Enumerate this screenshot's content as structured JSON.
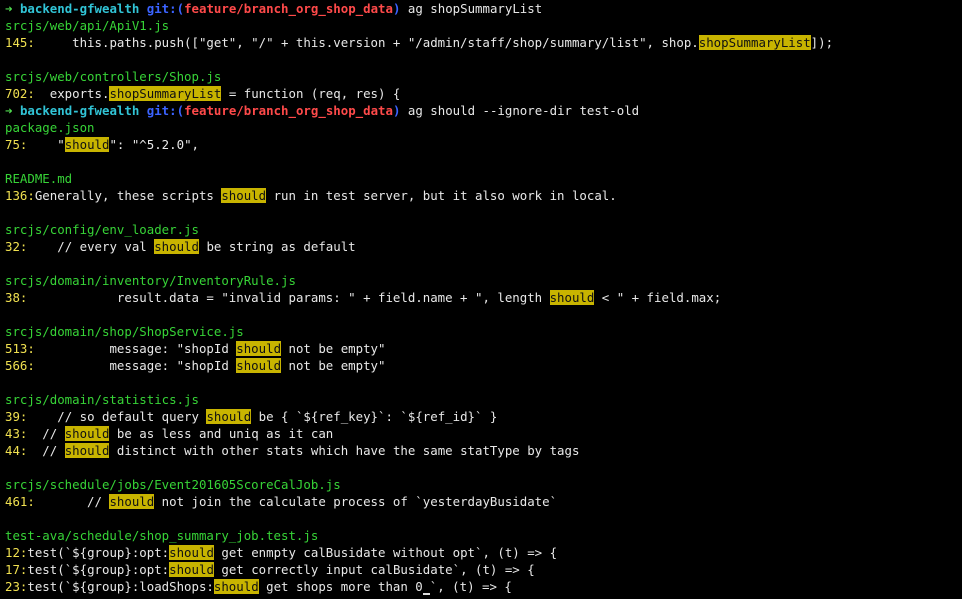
{
  "prompt": {
    "arrow": "➜",
    "dir": "backend-gfwealth",
    "git_prefix": "git:(",
    "branch": "feature/branch_org_shop_data",
    "git_suffix": ")"
  },
  "commands": {
    "first": "ag shopSummaryList",
    "second": "ag should --ignore-dir test-old"
  },
  "results1": [
    {
      "path": "srcjs/web/api/ApiV1.js",
      "lines": [
        {
          "no": "145:",
          "before": "     this.paths.push([\"get\", \"/\" + this.version + \"/admin/staff/shop/summary/list\", shop.",
          "match": "shopSummaryList",
          "after": "]);"
        }
      ]
    },
    {
      "path": "srcjs/web/controllers/Shop.js",
      "lines": [
        {
          "no": "702:",
          "before": "  exports.",
          "match": "shopSummaryList",
          "after": " = function (req, res) {"
        }
      ]
    }
  ],
  "results2": [
    {
      "path": "package.json",
      "lines": [
        {
          "no": "75:",
          "before": "    \"",
          "match": "should",
          "after": "\": \"^5.2.0\","
        }
      ]
    },
    {
      "path": "README.md",
      "lines": [
        {
          "no": "136:",
          "before": "Generally, these scripts ",
          "match": "should",
          "after": " run in test server, but it also work in local."
        }
      ]
    },
    {
      "path": "srcjs/config/env_loader.js",
      "lines": [
        {
          "no": "32:",
          "before": "    // every val ",
          "match": "should",
          "after": " be string as default"
        }
      ]
    },
    {
      "path": "srcjs/domain/inventory/InventoryRule.js",
      "lines": [
        {
          "no": "38:",
          "before": "            result.data = \"invalid params: \" + field.name + \", length ",
          "match": "should",
          "after": " < \" + field.max;"
        }
      ]
    },
    {
      "path": "srcjs/domain/shop/ShopService.js",
      "lines": [
        {
          "no": "513:",
          "before": "          message: \"shopId ",
          "match": "should",
          "after": " not be empty\""
        },
        {
          "no": "566:",
          "before": "          message: \"shopId ",
          "match": "should",
          "after": " not be empty\""
        }
      ]
    },
    {
      "path": "srcjs/domain/statistics.js",
      "lines": [
        {
          "no": "39:",
          "before": "    // so default query ",
          "match": "should",
          "after": " be { `${ref_key}`: `${ref_id}` }"
        },
        {
          "no": "43:",
          "before": "  // ",
          "match": "should",
          "after": " be as less and uniq as it can"
        },
        {
          "no": "44:",
          "before": "  // ",
          "match": "should",
          "after": " distinct with other stats which have the same statType by tags"
        }
      ]
    },
    {
      "path": "srcjs/schedule/jobs/Event201605ScoreCalJob.js",
      "lines": [
        {
          "no": "461:",
          "before": "       // ",
          "match": "should",
          "after": " not join the calculate process of `yesterdayBusidate`"
        }
      ]
    },
    {
      "path": "test-ava/schedule/shop_summary_job.test.js",
      "lines": [
        {
          "no": "12:",
          "before": "test(`${group}:opt:",
          "match": "should",
          "after": " get enmpty calBusidate without opt`, (t) => {"
        },
        {
          "no": "17:",
          "before": "test(`${group}:opt:",
          "match": "should",
          "after": " get correctly input calBusidate`, (t) => {"
        },
        {
          "no": "23:",
          "before": "test(`${group}:loadShops:",
          "match": "should",
          "after": " get shops more than 0",
          "cursor": true,
          "tail": "`, (t) => {"
        }
      ]
    }
  ],
  "colors": {
    "background": "#000000",
    "arrow": "#4fd94f",
    "dir": "#31c4d6",
    "git": "#3b63ff",
    "branch": "#ff4a4a",
    "path": "#37d437",
    "lineno": "#f0e050",
    "highlight": "#c8b400"
  }
}
